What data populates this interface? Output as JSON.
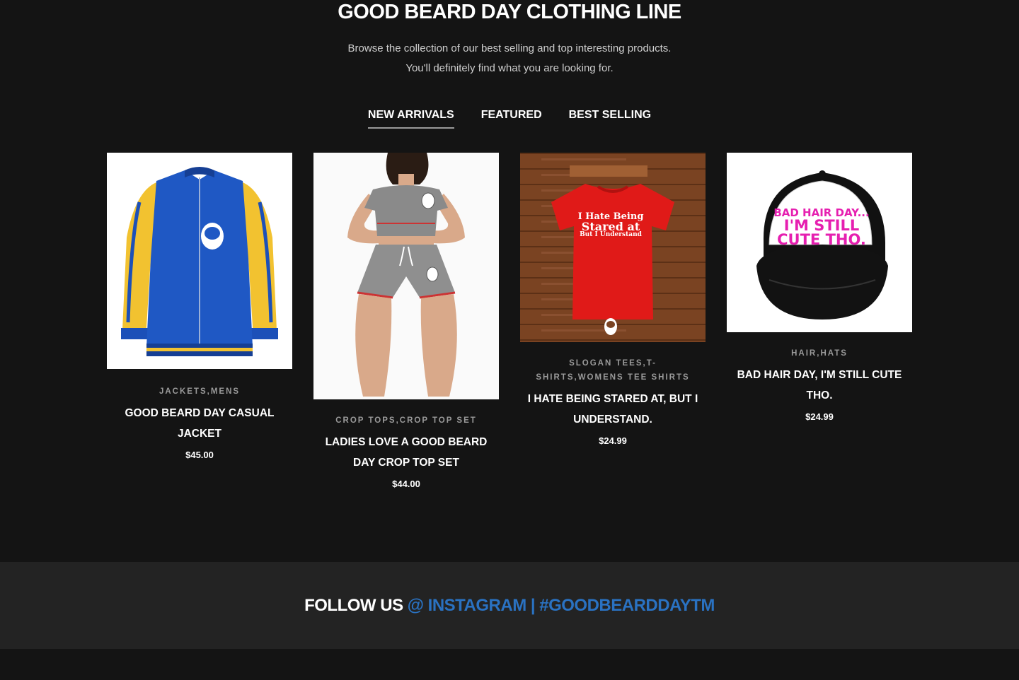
{
  "section": {
    "title": "GOOD BEARD DAY CLOTHING LINE",
    "intro_line1": "Browse the collection of our best selling and top interesting products.",
    "intro_line2": "You'll definitely find what you are looking for."
  },
  "tabs": [
    {
      "label": "NEW ARRIVALS",
      "active": true
    },
    {
      "label": "FEATURED",
      "active": false
    },
    {
      "label": "BEST SELLING",
      "active": false
    }
  ],
  "products": [
    {
      "categories": [
        "JACKETS",
        "MENS"
      ],
      "name": "GOOD BEARD DAY CASUAL JACKET",
      "price": "$45.00"
    },
    {
      "categories": [
        "CROP TOPS",
        "CROP TOP SET"
      ],
      "name": "LADIES LOVE A GOOD BEARD DAY CROP TOP SET",
      "price": "$44.00"
    },
    {
      "categories": [
        "SLOGAN TEES",
        "T-SHIRTS",
        "WOMENS TEE SHIRTS"
      ],
      "name": "I HATE BEING STARED AT, BUT I UNDERSTAND.",
      "price": "$24.99",
      "image_text": [
        "I Hate Being",
        "Stared at",
        "But I Understand"
      ]
    },
    {
      "categories": [
        "HAIR",
        "HATS"
      ],
      "name": "BAD HAIR DAY, I'M STILL CUTE THO.",
      "price": "$24.99",
      "image_text": [
        "BAD HAIR DAY...",
        "I'M STILL",
        "CUTE THO."
      ]
    }
  ],
  "follow": {
    "lead": "FOLLOW US",
    "link": "@ INSTAGRAM | #GOODBEARDDAYTM"
  },
  "colors": {
    "background": "#141414",
    "footer_band": "#232323",
    "link_blue": "#2a72c2",
    "category_gray": "#9a9a9a"
  }
}
